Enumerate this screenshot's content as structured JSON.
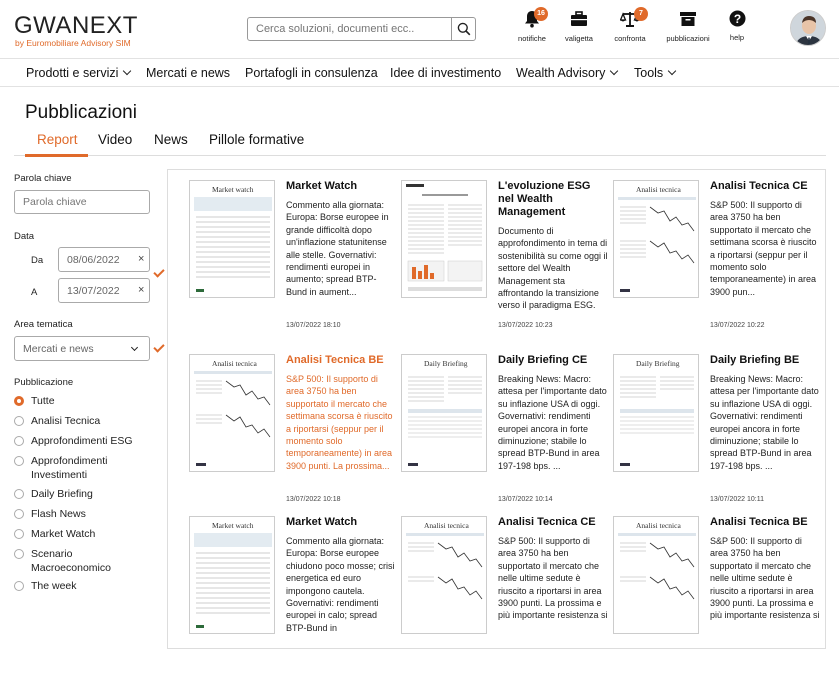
{
  "header": {
    "logo": "GWANEXT",
    "logo_sub": "by Euromobiliare Advisory SIM",
    "search_placeholder": "Cerca soluzioni, documenti ecc..",
    "icons": [
      {
        "label": "notifiche",
        "icon": "bell-icon",
        "badge": "16"
      },
      {
        "label": "valigetta",
        "icon": "briefcase-icon",
        "badge": ""
      },
      {
        "label": "confronta",
        "icon": "scales-icon",
        "badge": "7"
      },
      {
        "label": "pubblicazioni",
        "icon": "archive-icon",
        "badge": ""
      },
      {
        "label": "help",
        "icon": "help-icon",
        "badge": ""
      }
    ]
  },
  "nav": [
    "Prodotti e servizi",
    "Mercati e news",
    "Portafogli in consulenza",
    "Idee di investimento",
    "Wealth Advisory",
    "Tools"
  ],
  "page_title": "Pubblicazioni",
  "tabs": [
    "Report",
    "Video",
    "News",
    "Pillole formative"
  ],
  "filters": {
    "keyword_label": "Parola chiave",
    "keyword_placeholder": "Parola chiave",
    "date_label": "Data",
    "from_label": "Da",
    "from_value": "08/06/2022",
    "to_label": "A",
    "to_value": "13/07/2022",
    "area_label": "Area tematica",
    "area_value": "Mercati e news",
    "pub_label": "Pubblicazione",
    "pub_options": [
      "Tutte",
      "Analisi Tecnica",
      "Approfondimenti ESG",
      "Approfondimenti Investimenti",
      "Daily Briefing",
      "Flash News",
      "Market Watch",
      "Scenario Macroeconomico",
      "The week"
    ]
  },
  "cards": [
    {
      "title": "Market Watch",
      "thumb": "Market watch",
      "desc": "Commento alla giornata: Europa: Borse europee in grande difficoltà dopo un'inflazione statunitense alle stelle. Governativi: rendimenti europei in aumento; spread BTP-Bund in aument...",
      "date": "13/07/2022 18:10"
    },
    {
      "title": "L'evoluzione ESG nel Wealth Management",
      "thumb": "",
      "desc": "Documento di approfondimento in tema di sostenibilità su come oggi il settore del Wealth Management sta affrontando la transizione verso il paradigma ESG.",
      "date": "13/07/2022 10:23"
    },
    {
      "title": "Analisi Tecnica CE",
      "thumb": "Analisi tecnica",
      "desc": "S&P 500: Il supporto di area 3750 ha ben supportato il mercato che settimana scorsa è riuscito a riportarsi (seppur per il momento solo temporaneamente) in area 3900 pun...",
      "date": "13/07/2022 10:22"
    },
    {
      "title": "Analisi Tecnica BE",
      "thumb": "Analisi tecnica",
      "desc": "S&P 500: Il supporto di area 3750 ha ben supportato il mercato che settimana scorsa è riuscito a riportarsi (seppur per il momento solo temporaneamente) in area 3900 punti. La prossima...",
      "date": "13/07/2022 10:18"
    },
    {
      "title": "Daily Briefing CE",
      "thumb": "Daily Briefing",
      "desc": "Breaking News: Macro: attesa per l'importante dato su inflazione USA di oggi. Governativi: rendimenti europei ancora in forte diminuzione; stabile lo spread BTP-Bund in area 197-198 bps. ...",
      "date": "13/07/2022 10:14"
    },
    {
      "title": "Daily Briefing BE",
      "thumb": "Daily Briefing",
      "desc": "Breaking News: Macro: attesa per l'importante dato su inflazione USA di oggi. Governativi: rendimenti europei ancora in forte diminuzione; stabile lo spread BTP-Bund in area 197-198 bps. ...",
      "date": "13/07/2022 10:11"
    },
    {
      "title": "Market Watch",
      "thumb": "Market watch",
      "desc": "Commento alla giornata: Europa: Borse europee chiudono poco mosse; crisi energetica ed euro impongono cautela. Governativi: rendimenti europei in calo; spread BTP-Bund in",
      "date": ""
    },
    {
      "title": "Analisi Tecnica CE",
      "thumb": "Analisi tecnica",
      "desc": "S&P 500: Il supporto di area 3750 ha ben supportato il mercato che nelle ultime sedute è riuscito a riportarsi in area 3900 punti. La prossima e più importante resistenza si",
      "date": ""
    },
    {
      "title": "Analisi Tecnica BE",
      "thumb": "Analisi tecnica",
      "desc": "S&P 500: Il supporto di area 3750 ha ben supportato il mercato che nelle ultime sedute è riuscito a riportarsi in area 3900 punti. La prossima e più importante resistenza si",
      "date": ""
    }
  ],
  "colors": {
    "accent": "#e06a2a"
  }
}
